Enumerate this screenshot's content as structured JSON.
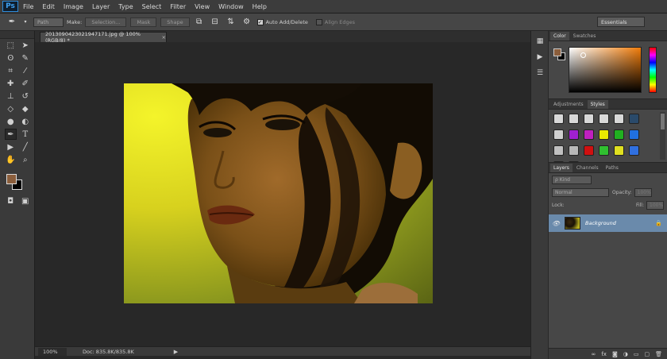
{
  "app": {
    "logo": "Ps"
  },
  "menu": [
    "File",
    "Edit",
    "Image",
    "Layer",
    "Type",
    "Select",
    "Filter",
    "View",
    "Window",
    "Help"
  ],
  "options": {
    "mode_value": "Path",
    "make_label": "Make:",
    "selection_btn": "Selection...",
    "mask_btn": "Mask",
    "shape_btn": "Shape",
    "auto_add_delete": "Auto Add/Delete",
    "align_edges": "Align Edges",
    "workspace": "Essentials"
  },
  "document": {
    "tab_title": "2013090423021947171.jpg @ 100% (RGB/8) *",
    "close": "×"
  },
  "status": {
    "zoom": "100%",
    "doc_info": "Doc: 835.8K/835.8K",
    "arrow": "▶"
  },
  "panels": {
    "color_tabs": [
      "Color",
      "Swatches"
    ],
    "adj_tabs": [
      "Adjustments",
      "Styles"
    ],
    "layers_tabs": [
      "Layers",
      "Channels",
      "Paths"
    ],
    "kind_label": "ρ Kind",
    "blend_mode": "Normal",
    "opacity_label": "Opacity:",
    "opacity_value": "100%",
    "lock_label": "Lock:",
    "fill_label": "Fill:",
    "fill_value": "100%",
    "layer_name": "Background"
  },
  "colors": {
    "foreground": "#8b5e3c",
    "background": "#000000",
    "accent": "#6a8aab"
  },
  "style_swatches": [
    "#d8d8d8",
    "#d8d8d8",
    "#d8d8d8",
    "#d8d8d8",
    "#d8d8d8",
    "#2a4a6a",
    "#cfcfcf",
    "#a020d0",
    "#c020c0",
    "#e8e800",
    "#20b020",
    "#2070e0",
    "#c0c0c0",
    "#b8b8b8",
    "#d01010",
    "#30c030",
    "#e0e020",
    "#3070e0",
    "#d8d8d8",
    "#b0b0b0"
  ]
}
